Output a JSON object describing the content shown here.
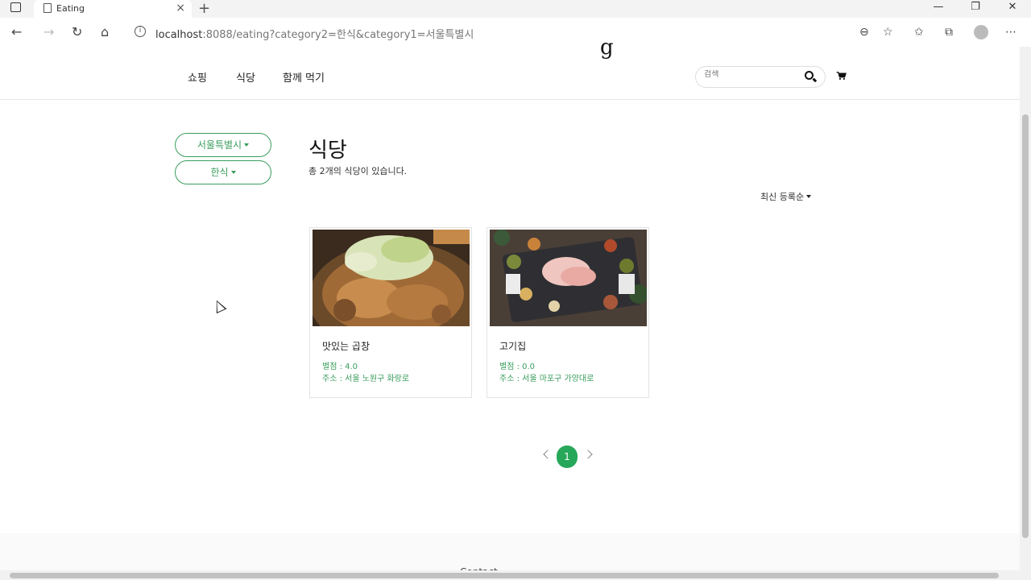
{
  "browser": {
    "tab_title": "Eating",
    "url_host": "localhost",
    "url_rest": ":8088/eating?category2=한식&category1=서울특별시"
  },
  "header": {
    "logo_fragment": "g",
    "menu": [
      "쇼핑",
      "식당",
      "함께 먹기"
    ],
    "search_placeholder": "검색"
  },
  "filters": {
    "region": "서울특별시",
    "category": "한식"
  },
  "main": {
    "title": "식당",
    "count_text": "총 2개의 식당이 있습니다.",
    "sort_label": "최신 등록순"
  },
  "cards": [
    {
      "name": "맛있는 곱창",
      "rating": "별점 : 4.0",
      "address": "주소 : 서울 노원구 화랑로"
    },
    {
      "name": "고기집",
      "rating": "별점 : 0.0",
      "address": "주소 : 서울 마포구 가양대로"
    }
  ],
  "pagination": {
    "current": "1"
  },
  "footer": {
    "text": "Contact"
  },
  "colors": {
    "accent": "#27a75a",
    "accent_text": "#3a9d5d"
  }
}
